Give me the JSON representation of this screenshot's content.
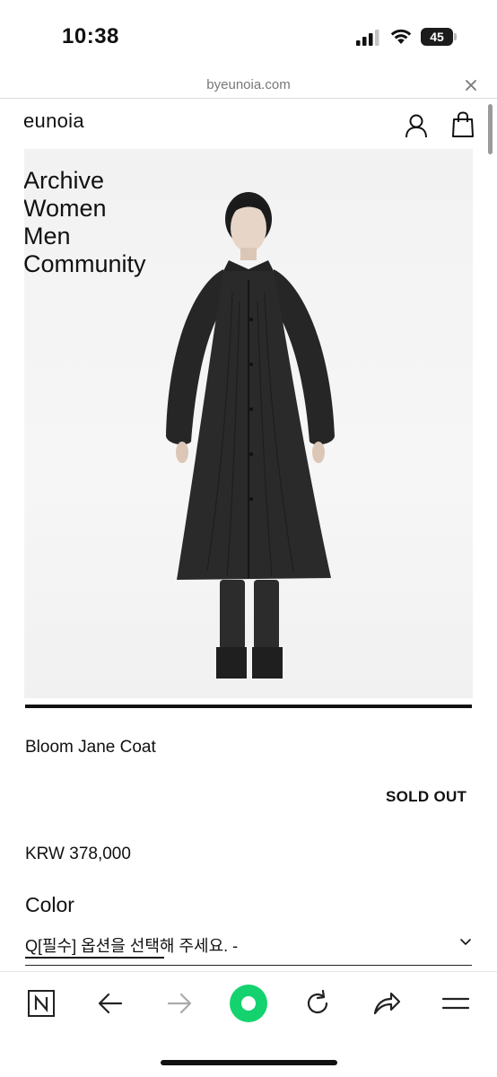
{
  "status_bar": {
    "time": "10:38",
    "battery": "45"
  },
  "browser": {
    "url": "byeunoia.com"
  },
  "site": {
    "logo": "eunoia",
    "nav": [
      "Archive",
      "Women",
      "Men",
      "Community"
    ]
  },
  "product": {
    "name": "Bloom Jane Coat",
    "status": "SOLD OUT",
    "price": "KRW 378,000",
    "option_label": "Color",
    "option_select": "Q[필수] 옵션을 선택해 주세요. -"
  },
  "colors": {
    "home_accent": "#14d36e",
    "text": "#111111"
  },
  "toolbar": {
    "icons": [
      "naver-n-icon",
      "back-arrow-icon",
      "forward-arrow-icon",
      "home-icon",
      "reload-icon",
      "share-icon",
      "menu-icon"
    ]
  }
}
